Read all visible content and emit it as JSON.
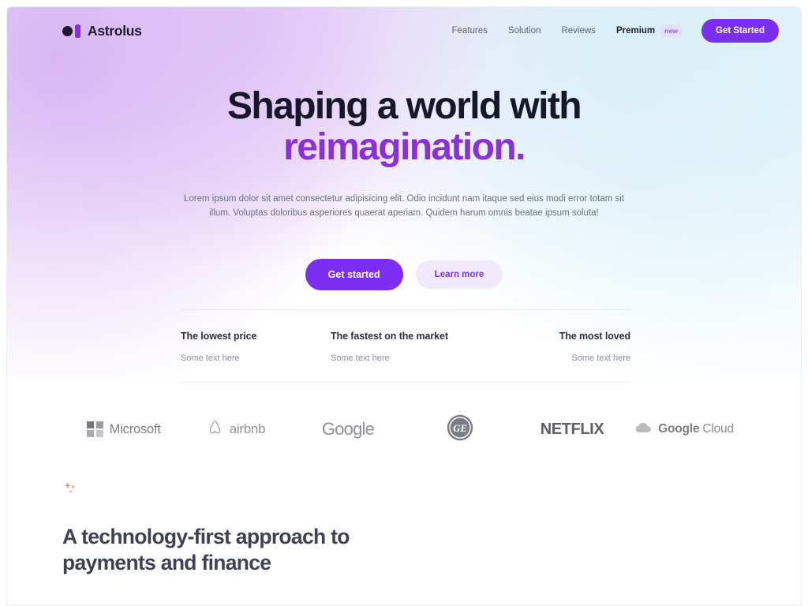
{
  "brand": {
    "name": "Astrolus",
    "mark_dot_color": "#1b1b2b",
    "mark_bar_color": "#8b2fd6"
  },
  "nav": {
    "links": [
      {
        "label": "Features"
      },
      {
        "label": "Solution"
      },
      {
        "label": "Reviews"
      }
    ],
    "premium_label": "Premium",
    "badge_label": "new",
    "cta_label": "Get Started"
  },
  "hero": {
    "title_line1": "Shaping a world with",
    "title_line2": "reimagination.",
    "accent_color": "#8b2fd6",
    "subtitle": "Lorem ipsum dolor sit amet consectetur adipisicing elit. Odio incidunt nam itaque sed eius modi error totam sit illum. Voluptas doloribus asperiores quaerat aperiam. Quidem harum omnis beatae ipsum soluta!",
    "primary_cta": "Get started",
    "secondary_cta": "Learn more"
  },
  "features": [
    {
      "title": "The lowest price",
      "text": "Some text here"
    },
    {
      "title": "The fastest on the market",
      "text": "Some text here"
    },
    {
      "title": "The most loved",
      "text": "Some text here"
    }
  ],
  "logos": [
    {
      "name": "Microsoft"
    },
    {
      "name": "airbnb"
    },
    {
      "name": "Google"
    },
    {
      "name": "GE"
    },
    {
      "name": "NETFLIX"
    },
    {
      "name": "Google",
      "name2": "Cloud"
    }
  ],
  "bottom": {
    "icon": "sparkles-icon",
    "icon_color": "#f08a5d",
    "title": "A technology-first approach to payments and finance"
  }
}
